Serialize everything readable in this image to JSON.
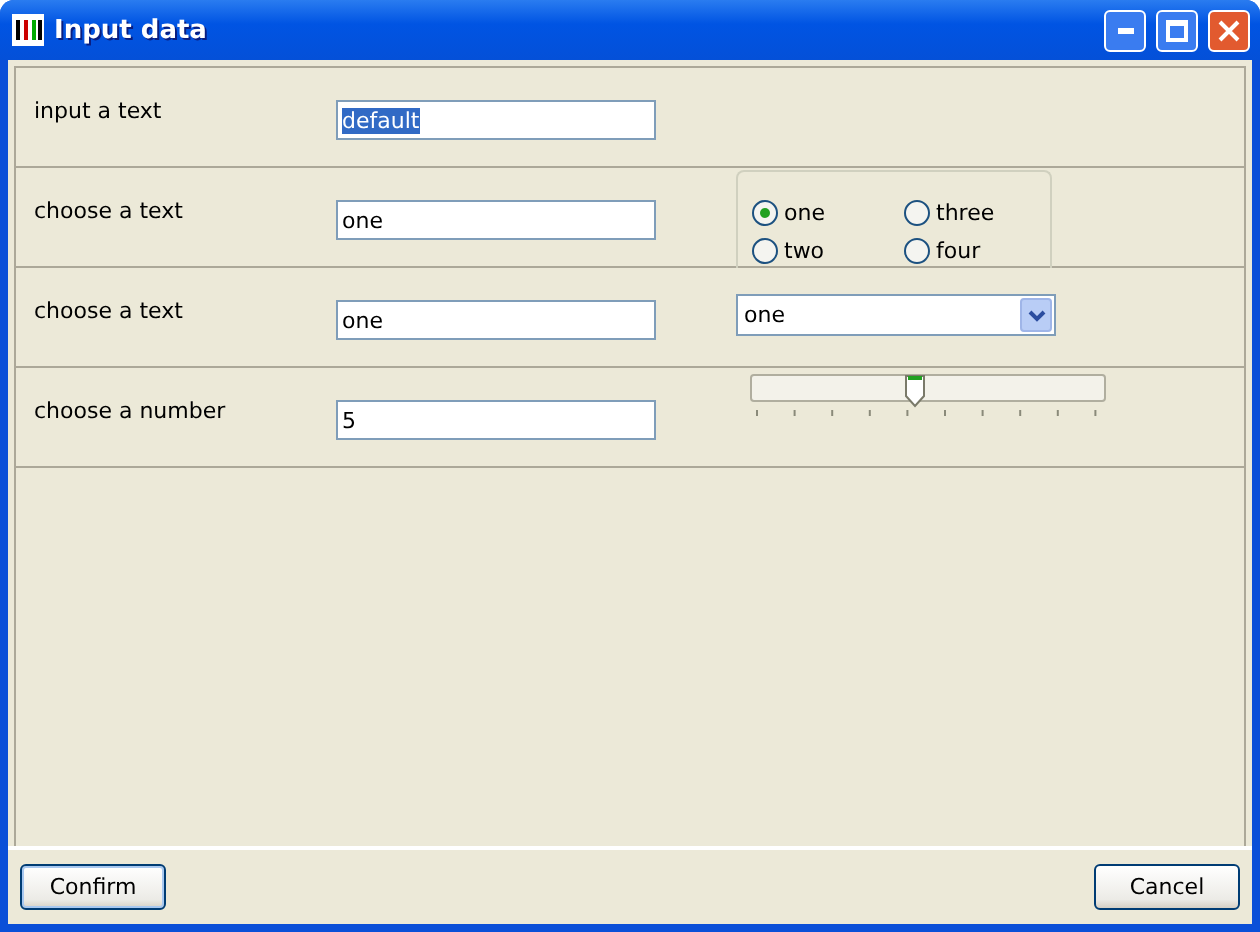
{
  "window": {
    "title": "Input data"
  },
  "rows": [
    {
      "kind": "text",
      "label": "input a text",
      "value": "default",
      "value_highlighted": true
    },
    {
      "kind": "radio",
      "label": "choose a text",
      "value": "one",
      "value_highlighted": false,
      "options": [
        {
          "label": "one",
          "selected": true
        },
        {
          "label": "two",
          "selected": false
        },
        {
          "label": "three",
          "selected": false
        },
        {
          "label": "four",
          "selected": false
        }
      ]
    },
    {
      "kind": "dropdown",
      "label": "choose a text",
      "value": "one",
      "value_highlighted": false,
      "choice": "one"
    },
    {
      "kind": "slider",
      "label": "choose a number",
      "value": "5",
      "value_highlighted": false,
      "level": 0.44
    }
  ],
  "buttons": [
    {
      "label": "Confirm",
      "default": true
    },
    {
      "label": "Cancel",
      "default": false
    }
  ]
}
